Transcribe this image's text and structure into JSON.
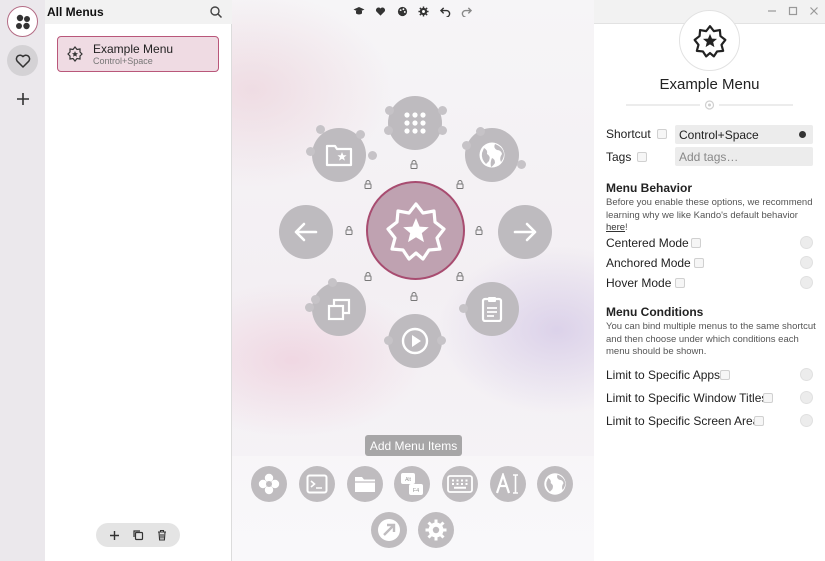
{
  "collections": {
    "all_label": "All Menus"
  },
  "menus": [
    {
      "name": "Example Menu",
      "shortcut": "Control+Space"
    }
  ],
  "preview": {
    "add_items_label": "Add Menu Items"
  },
  "properties": {
    "menu_name": "Example Menu",
    "shortcut_label": "Shortcut",
    "shortcut_value": "Control+Space",
    "tags_label": "Tags",
    "tags_placeholder": "Add tags…",
    "behavior_title": "Menu Behavior",
    "behavior_desc_prefix": "Before you enable these options, we recommend learning why we like Kando's default behavior ",
    "behavior_link": "here",
    "behavior_desc_suffix": "!",
    "centered_mode": "Centered Mode",
    "anchored_mode": "Anchored Mode",
    "hover_mode": "Hover Mode",
    "conditions_title": "Menu Conditions",
    "conditions_desc": "You can bind multiple menus to the same shortcut and then choose under which conditions each menu should be shown.",
    "limit_apps": "Limit to Specific Apps",
    "limit_titles": "Limit to Specific Window Titles",
    "limit_area": "Limit to Specific Screen Area"
  },
  "icons": {
    "collections": [
      "kando-icon",
      "heart-icon",
      "plus-icon"
    ],
    "preview_toolbar": [
      "graduation-cap-icon",
      "heart-icon",
      "palette-icon",
      "gear-icon",
      "undo-icon",
      "redo-icon"
    ],
    "menu_nodes": [
      "apps-grid-icon",
      "globe-icon",
      "arrow-right-icon",
      "clipboard-icon",
      "play-icon",
      "windows-icon",
      "arrow-left-icon",
      "folder-star-icon"
    ],
    "center": "star-badge-icon",
    "tray": [
      "flower-icon",
      "terminal-icon",
      "folder-icon",
      "hotkey-icon",
      "keyboard-icon",
      "text-icon",
      "globe-icon",
      "redirect-icon",
      "settings-icon"
    ]
  },
  "colors": {
    "accent": "#b9577a",
    "selected_bg": "#efdbe3",
    "center_node": "#bfa2b1",
    "node": "#bebbbf"
  }
}
